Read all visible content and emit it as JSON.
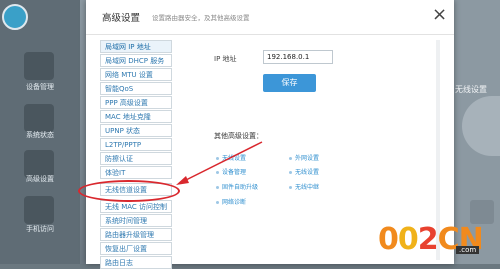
{
  "dialog": {
    "title": "高级设置",
    "subtitle": "设置路由器安全，及其他高级设置",
    "close_glyph": "×"
  },
  "menu": {
    "items": [
      {
        "label": "局域网 IP 地址"
      },
      {
        "label": "局域网 DHCP 服务"
      },
      {
        "label": "网络 MTU 设置"
      },
      {
        "label": "智能QoS"
      },
      {
        "label": "PPP 高级设置"
      },
      {
        "label": "MAC 地址克隆"
      },
      {
        "label": "UPNP 状态"
      },
      {
        "label": "L2TP/PPTP"
      },
      {
        "label": "防擦认证"
      },
      {
        "label": "体验IT"
      },
      {
        "label": "无线信道设置"
      },
      {
        "label": "无线 MAC 访问控制"
      },
      {
        "label": "系统时间管理"
      },
      {
        "label": "路由器升级管理"
      },
      {
        "label": "恢复出厂设置"
      },
      {
        "label": "路由日志"
      }
    ]
  },
  "form": {
    "ip_label": "IP 地址",
    "ip_value": "192.168.0.1",
    "save_label": "保存"
  },
  "other": {
    "title": "其他高级设置：",
    "links": [
      {
        "label": "无线设置"
      },
      {
        "label": "外网设置"
      },
      {
        "label": "设备管理"
      },
      {
        "label": "无线设置"
      },
      {
        "label": "固件自助升级"
      },
      {
        "label": "无线中继"
      },
      {
        "label": "网络诊断"
      }
    ]
  },
  "background": {
    "left_labels": [
      "设备管理",
      "系统状态",
      "高级设置",
      "手机访问"
    ],
    "right_label": "无线设置"
  },
  "watermark": {
    "part1": "0",
    "part2": "0",
    "part3": "2",
    "part4": "CN",
    "sub": ".com"
  },
  "colors": {
    "accent": "#3c96d8",
    "link": "#2f8fcf",
    "annotation": "#d9282e"
  }
}
